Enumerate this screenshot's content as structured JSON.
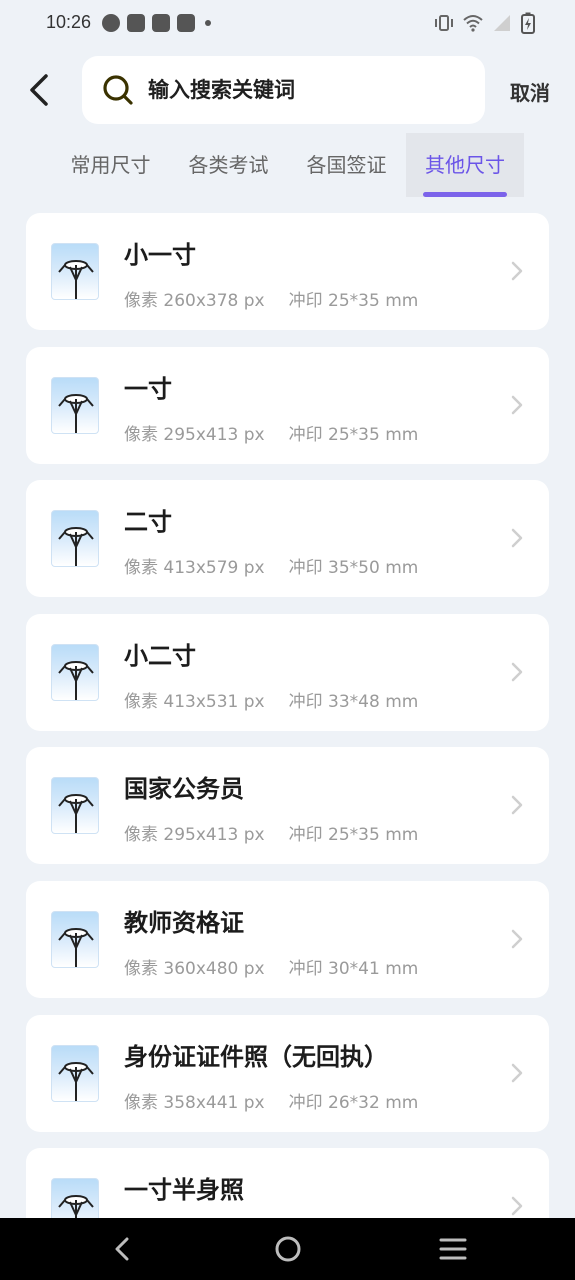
{
  "status_bar": {
    "time": "10:26",
    "left_icons": [
      "clock-icon",
      "bag-icon",
      "bag-icon",
      "bag-icon",
      "dot-icon"
    ],
    "right_icons": [
      "vibrate-icon",
      "wifi-icon",
      "signal-icon",
      "battery-charging-icon"
    ]
  },
  "header": {
    "back_icon": "chevron-left-icon",
    "search_placeholder": "输入搜索关键词",
    "search_value": "",
    "cancel_label": "取消"
  },
  "tabs": [
    {
      "label": "常用尺寸",
      "active": false
    },
    {
      "label": "各类考试",
      "active": false
    },
    {
      "label": "各国签证",
      "active": false
    },
    {
      "label": "其他尺寸",
      "active": true
    }
  ],
  "colors": {
    "accent": "#6b55e8",
    "background": "#eef2f7",
    "card": "#ffffff",
    "muted_text": "#9a9a9a"
  },
  "items": [
    {
      "title": "小一寸",
      "pixels": "像素 260x378 px",
      "print": "冲印 25*35 mm"
    },
    {
      "title": "一寸",
      "pixels": "像素 295x413 px",
      "print": "冲印 25*35 mm"
    },
    {
      "title": "二寸",
      "pixels": "像素 413x579 px",
      "print": "冲印 35*50 mm"
    },
    {
      "title": "小二寸",
      "pixels": "像素 413x531 px",
      "print": "冲印 33*48 mm"
    },
    {
      "title": "国家公务员",
      "pixels": "像素 295x413 px",
      "print": "冲印 25*35 mm"
    },
    {
      "title": "教师资格证",
      "pixels": "像素 360x480 px",
      "print": "冲印 30*41 mm"
    },
    {
      "title": "身份证证件照（无回执）",
      "pixels": "像素 358x441 px",
      "print": "冲印 26*32 mm"
    },
    {
      "title": "一寸半身照",
      "pixels": "",
      "print": ""
    }
  ],
  "nav_bar": {
    "icons": [
      "nav-back-icon",
      "nav-home-icon",
      "nav-menu-icon"
    ]
  }
}
